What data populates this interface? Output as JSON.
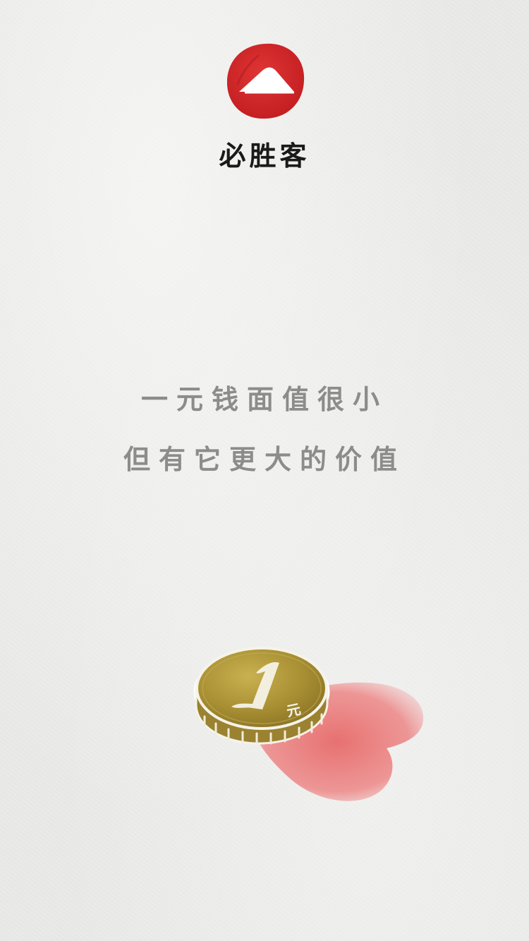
{
  "brand": {
    "name": "必胜客"
  },
  "slogan": {
    "line1": "一元钱面值很小",
    "line2": "但有它更大的价值"
  },
  "coin": {
    "label": "元"
  },
  "colors": {
    "logo_red": "#d42a2a",
    "text_gray": "#8c8c8c",
    "brand_black": "#1a1a1a",
    "coin_gold": "#b39a3b",
    "heart_red": "#e86565"
  }
}
